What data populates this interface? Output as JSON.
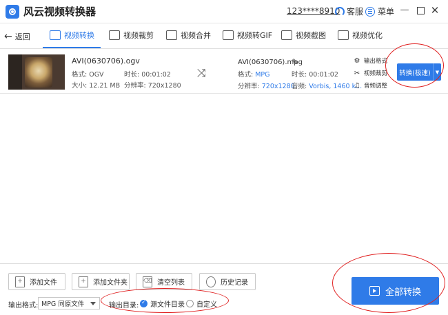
{
  "app": {
    "title": "风云视频转换器",
    "account": "123****8910",
    "service": "客服",
    "menu": "菜单"
  },
  "nav": {
    "back": "返回",
    "tabs": [
      "视频转换",
      "视频裁剪",
      "视频合并",
      "视频转GIF",
      "视频截图",
      "视频优化"
    ],
    "active_tab": "视频转换"
  },
  "file": {
    "source_name": "AVI(0630706).ogv",
    "source_format": "格式: OGV",
    "source_duration": "时长: 00:01:02",
    "source_size": "大小: 12.21 MB",
    "source_resolution": "分辨率: 720x1280",
    "output_name": "AVI(0630706).mpg",
    "output_format_label": "格式: ",
    "output_format_value": "MPG",
    "output_duration": "时长: 00:01:02",
    "output_resolution_label": "分辨率: ",
    "output_resolution_value": "720x1280",
    "output_audio_label": "音频: ",
    "output_audio_value": "Vorbis, 1460 k...",
    "options": [
      "输出格式",
      "视频裁剪",
      "音频调整"
    ],
    "convert_button": "转换(极速)"
  },
  "bottom": {
    "buttons": [
      "添加文件",
      "添加文件夹",
      "清空列表",
      "历史记录"
    ],
    "output_format_label": "输出格式:",
    "output_format_value": "MPG 同原文件",
    "output_dir_label": "输出目录:",
    "dir_options": [
      "源文件目录",
      "自定义"
    ],
    "dir_selected": "源文件目录",
    "convert_all": "全部转换"
  },
  "colors": {
    "accent": "#2f7be8",
    "annotation": "#e02020"
  }
}
